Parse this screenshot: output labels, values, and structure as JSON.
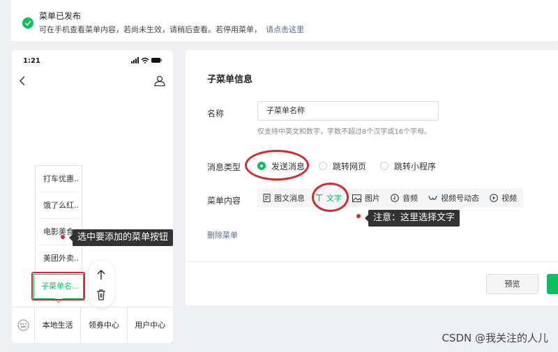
{
  "notice": {
    "title": "菜单已发布",
    "desc": "可在手机查看菜单内容，若尚未生效，请稍后查看。若停用菜单，",
    "link": "请点击这里"
  },
  "phone": {
    "time": "1:21",
    "submenu_items": [
      "打车优惠...",
      "饿了么红...",
      "电影美食",
      "美团外卖..."
    ],
    "active_sub": "子菜单名...",
    "tabs": [
      "本地生活",
      "领券中心",
      "用户中心"
    ]
  },
  "tooltip_left": "选中要添加的菜单按钮",
  "panel": {
    "heading": "子菜单信息",
    "name_label": "名称",
    "name_value": "子菜单名称",
    "name_hint": "仅支持中英文和数字，字数不超过8个汉字或16个字母。",
    "msg_type_label": "消息类型",
    "msg_types": [
      "发送消息",
      "跳转网页",
      "跳转小程序"
    ],
    "content_label": "菜单内容",
    "content_tabs": [
      "图文消息",
      "文字",
      "图片",
      "音频",
      "视频号动态",
      "视频"
    ],
    "delete_label": "删除菜单",
    "preview_label": "预览"
  },
  "tooltip_right": "注意：这里选择文字",
  "watermark": "CSDN @我关注的人儿",
  "colors": {
    "accent": "#07c160",
    "annotation_red": "#d7282f",
    "link": "#576b95"
  }
}
